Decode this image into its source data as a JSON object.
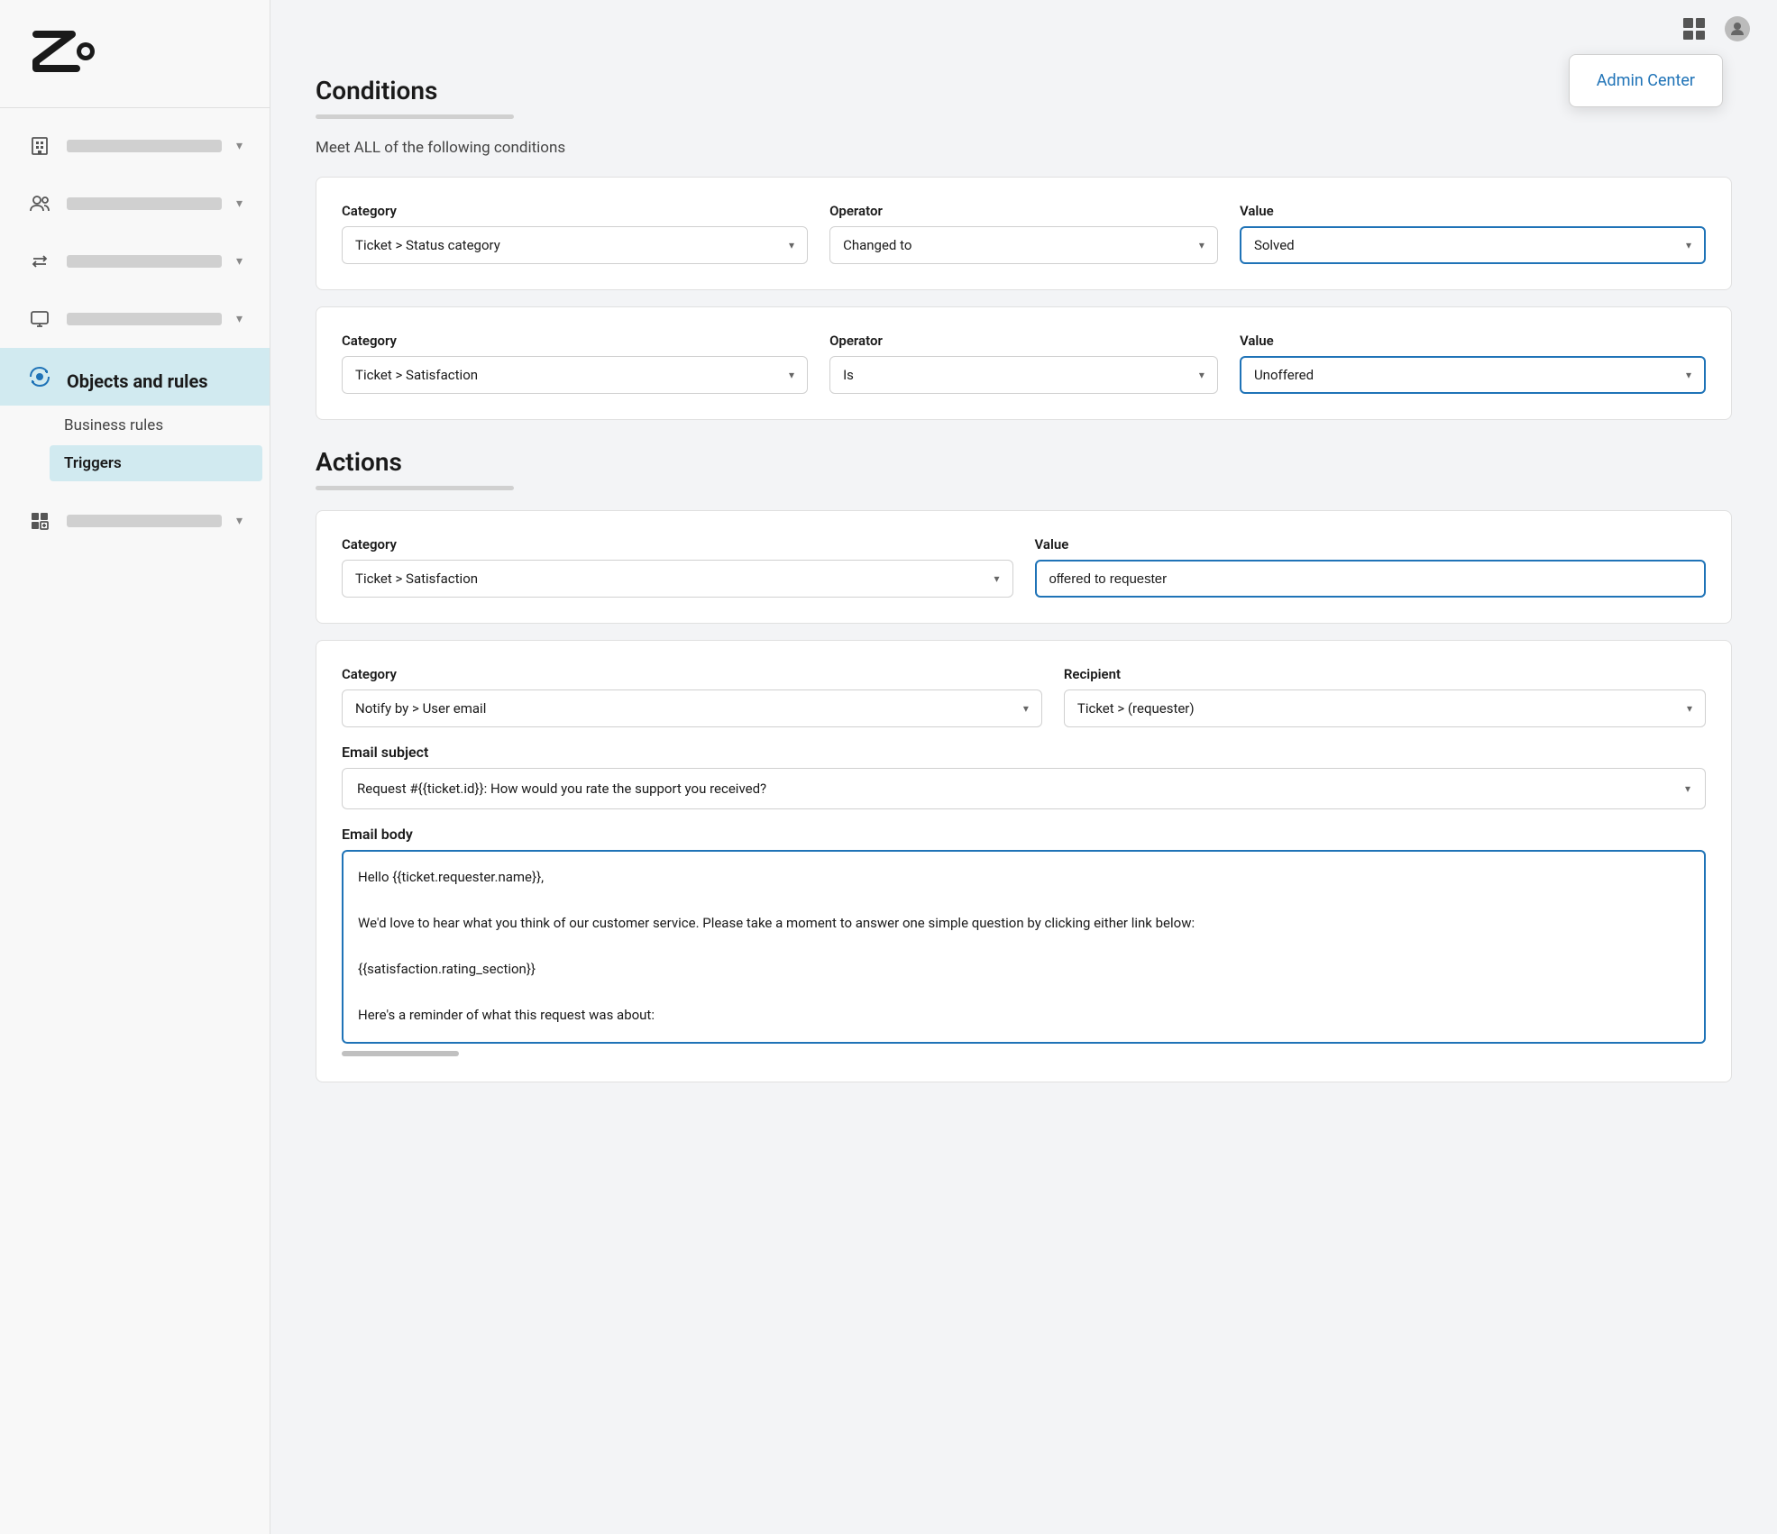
{
  "sidebar": {
    "logo_alt": "Zendesk logo",
    "nav_items": [
      {
        "id": "buildings",
        "label_bar": true,
        "has_chevron": true
      },
      {
        "id": "people",
        "label_bar": true,
        "has_chevron": true
      },
      {
        "id": "arrows",
        "label_bar": true,
        "has_chevron": true
      },
      {
        "id": "monitor",
        "label_bar": true,
        "has_chevron": true
      },
      {
        "id": "objects",
        "label": "Objects and rules",
        "active": true,
        "has_chevron": false
      },
      {
        "id": "apps",
        "label_bar": true,
        "has_chevron": true
      }
    ],
    "sub_items": [
      {
        "id": "business-rules",
        "label": "Business rules"
      },
      {
        "id": "triggers",
        "label": "Triggers",
        "active": true
      }
    ]
  },
  "topbar": {
    "admin_center_label": "Admin Center"
  },
  "conditions": {
    "title": "Conditions",
    "subtitle": "Meet ALL of the following conditions",
    "condition1": {
      "category_label": "Category",
      "category_value": "Ticket > Status category",
      "operator_label": "Operator",
      "operator_value": "Changed to",
      "value_label": "Value",
      "value_value": "Solved"
    },
    "condition2": {
      "category_label": "Category",
      "category_value": "Ticket > Satisfaction",
      "operator_label": "Operator",
      "operator_value": "Is",
      "value_label": "Value",
      "value_value": "Unoffered"
    }
  },
  "actions": {
    "title": "Actions",
    "action1": {
      "category_label": "Category",
      "category_value": "Ticket > Satisfaction",
      "value_label": "Value",
      "value_value": "offered to requester"
    },
    "action2": {
      "category_label": "Category",
      "category_value": "Notify by > User email",
      "recipient_label": "Recipient",
      "recipient_value": "Ticket > (requester)",
      "email_subject_label": "Email subject",
      "email_subject_value": "Request #{{ticket.id}}: How would you rate the support you received?",
      "email_body_label": "Email body",
      "email_body_value": "Hello {{ticket.requester.name}},\n\nWe'd love to hear what you think of our customer service. Please take a moment to answer one simple question by clicking either link below:\n\n{{satisfaction.rating_section}}\n\nHere's a reminder of what this request was about:"
    }
  }
}
